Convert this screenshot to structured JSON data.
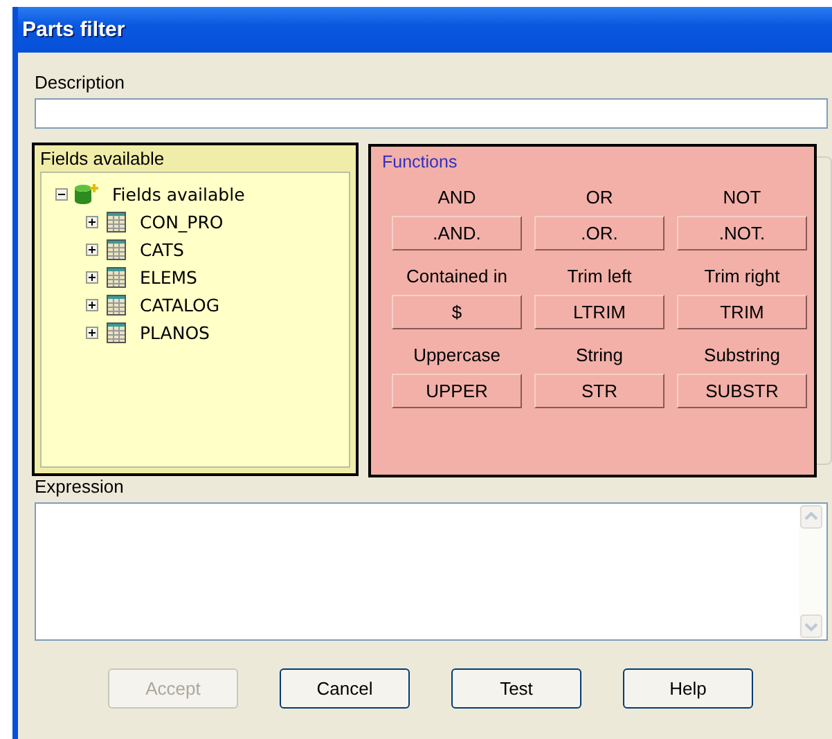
{
  "window": {
    "title": "Parts filter"
  },
  "description": {
    "label": "Description"
  },
  "fields_panel": {
    "title": "Fields available",
    "tree": [
      {
        "label": "Fields available",
        "expanded": true,
        "children": [
          {
            "label": "CON_PRO",
            "expanded": false
          },
          {
            "label": "CATS",
            "expanded": false
          },
          {
            "label": "ELEMS",
            "expanded": false
          },
          {
            "label": "CATALOG",
            "expanded": false
          },
          {
            "label": "PLANOS",
            "expanded": false
          }
        ]
      }
    ]
  },
  "functions": {
    "title": "Functions",
    "items": [
      {
        "label": "AND",
        "button": ".AND."
      },
      {
        "label": "OR",
        "button": ".OR."
      },
      {
        "label": "NOT",
        "button": ".NOT."
      },
      {
        "label": "Contained in",
        "button": "$"
      },
      {
        "label": "Trim left",
        "button": "LTRIM"
      },
      {
        "label": "Trim right",
        "button": "TRIM"
      },
      {
        "label": "Uppercase",
        "button": "UPPER"
      },
      {
        "label": "String",
        "button": "STR"
      },
      {
        "label": "Substring",
        "button": "SUBSTR"
      }
    ]
  },
  "expression": {
    "label": "Expression"
  },
  "buttons": [
    {
      "label": "Accept",
      "disabled": true
    },
    {
      "label": "Cancel",
      "disabled": false
    },
    {
      "label": "Test",
      "disabled": false
    },
    {
      "label": "Help",
      "disabled": false
    }
  ]
}
